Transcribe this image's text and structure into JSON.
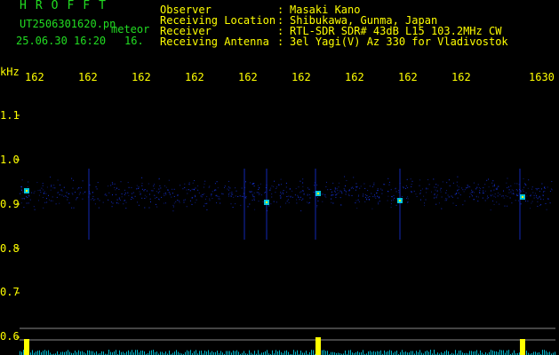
{
  "header": {
    "app_title": "HROFFT",
    "filename": "UT2506301620.pn",
    "mode": "meteor",
    "timestamp": "25.06.30 16:20",
    "time_suffix": "16."
  },
  "station_info": [
    {
      "label": "Observer",
      "sep": ":",
      "value": "Masaki Kano"
    },
    {
      "label": "Receiving Location",
      "sep": ":",
      "value": "Shibukawa, Gunma, Japan"
    },
    {
      "label": "Receiver",
      "sep": ":",
      "value": "RTL-SDR SDR# 43dB L15 103.2MHz CW"
    },
    {
      "label": "Receiving Antenna",
      "sep": ":",
      "value": "3el Yagi(V) Az 330 for Vladivostok"
    }
  ],
  "axes": {
    "y_unit": "kHz",
    "x_ticks": [
      "162",
      "162",
      "162",
      "162",
      "162",
      "162",
      "162",
      "162",
      "162",
      "1630"
    ],
    "y_ticks": [
      "1.1",
      "1.0",
      "0.9",
      "0.8",
      "0.7",
      "0.6"
    ]
  },
  "colors": {
    "text_green": "#22dd22",
    "text_yellow": "#ffff00",
    "background": "#000000",
    "echo_yellow": "#ffff00",
    "echo_cyan": "#00e5ff",
    "noise_blue": "#1a3aff"
  }
}
